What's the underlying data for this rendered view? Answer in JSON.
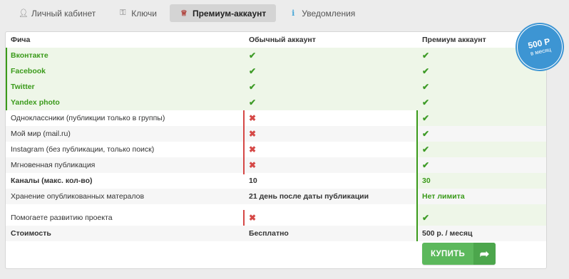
{
  "tabs": [
    {
      "label": "Личный кабинет",
      "icon": "user-icon"
    },
    {
      "label": "Ключи",
      "icon": "key-icon"
    },
    {
      "label": "Премиум-аккаунт",
      "icon": "trophy-icon",
      "active": true
    },
    {
      "label": "Уведомления",
      "icon": "info-icon"
    }
  ],
  "table": {
    "headers": [
      "Фича",
      "Обычный аккаунт",
      "Премиум аккаунт"
    ],
    "social_rows": [
      "Вконтакте",
      "Facebook",
      "Twitter",
      "Yandex photo"
    ],
    "limited_rows": [
      "Одноклассники (публикции только в группы)",
      "Мой мир (mail.ru)",
      "Instagram (без публикации, только поиск)",
      "Мгновенная публикация"
    ],
    "channels": {
      "label": "Каналы (макс. кол-во)",
      "basic": "10",
      "premium": "30"
    },
    "storage": {
      "label": "Хранение опубликованных матералов",
      "basic": "21 день после даты публикации",
      "premium": "Нет лимита"
    },
    "support": {
      "label": "Помогаете развитию проекта"
    },
    "cost": {
      "label": "Стоимость",
      "basic": "Бесплатно",
      "premium": "500 р. / месяц"
    }
  },
  "buy_button": {
    "label": "КУПИТЬ"
  },
  "badge": {
    "price": "500 Р",
    "period": "в месяц"
  },
  "colors": {
    "accent_green": "#5cb85c",
    "text_green": "#3a9a1a",
    "cross_red": "#d54846",
    "badge_blue": "#3d95d3"
  }
}
